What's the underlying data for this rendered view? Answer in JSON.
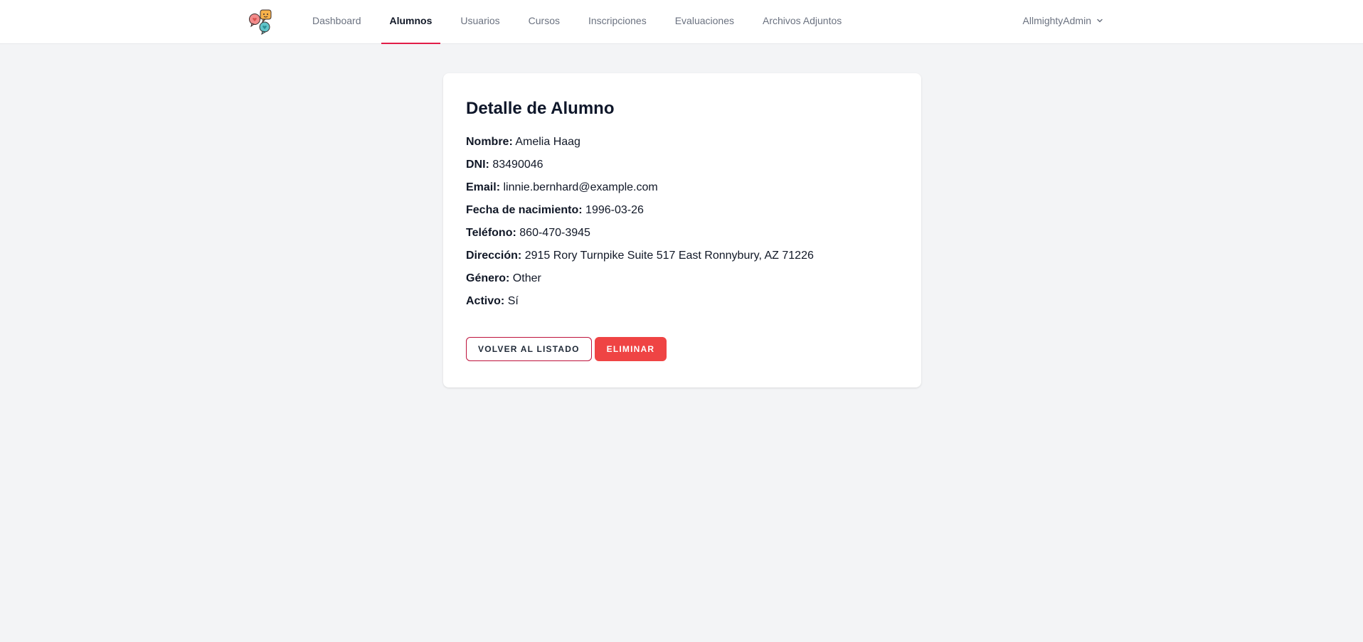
{
  "nav": {
    "links": [
      {
        "label": "Dashboard",
        "active": false
      },
      {
        "label": "Alumnos",
        "active": true
      },
      {
        "label": "Usuarios",
        "active": false
      },
      {
        "label": "Cursos",
        "active": false
      },
      {
        "label": "Inscripciones",
        "active": false
      },
      {
        "label": "Evaluaciones",
        "active": false
      },
      {
        "label": "Archivos Adjuntos",
        "active": false
      }
    ],
    "user": "AllmightyAdmin",
    "active_color": "#e11d48"
  },
  "detail": {
    "title": "Detalle de Alumno",
    "fields": [
      {
        "label": "Nombre:",
        "value": "Amelia Haag"
      },
      {
        "label": "DNI:",
        "value": "83490046"
      },
      {
        "label": "Email:",
        "value": "linnie.bernhard@example.com"
      },
      {
        "label": "Fecha de nacimiento:",
        "value": "1996-03-26"
      },
      {
        "label": "Teléfono:",
        "value": "860-470-3945"
      },
      {
        "label": "Dirección:",
        "value": "2915 Rory Turnpike Suite 517 East Ronnybury, AZ 71226"
      },
      {
        "label": "Género:",
        "value": "Other"
      },
      {
        "label": "Activo:",
        "value": "Sí"
      }
    ]
  },
  "actions": {
    "back_label": "Volver al listado",
    "delete_label": "Eliminar",
    "delete_color": "#ef4444"
  }
}
